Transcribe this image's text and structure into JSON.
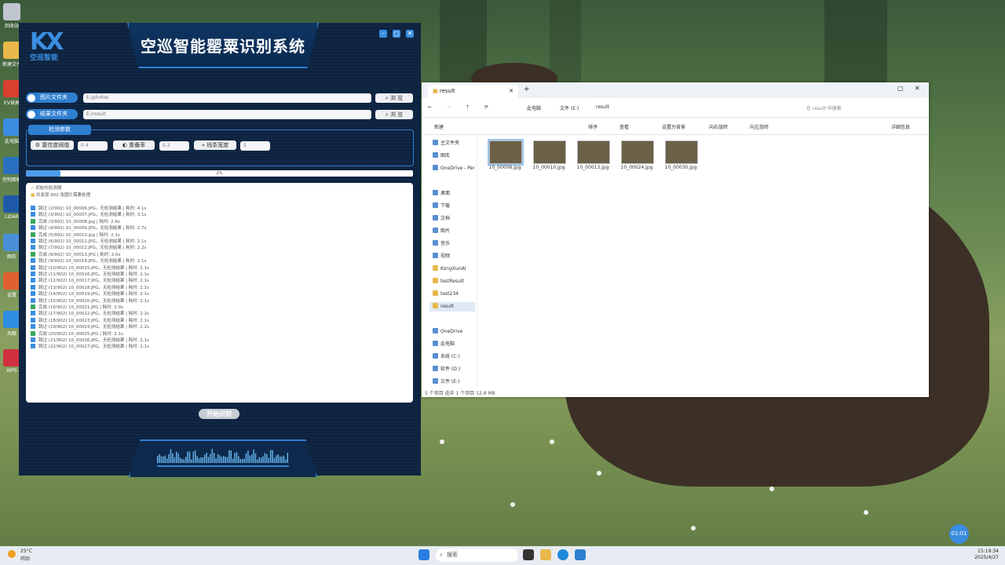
{
  "app": {
    "logo_text": "空巡智能",
    "title": "空巡智能罂粟识别系统",
    "window_buttons": [
      "–",
      "▢",
      "✕"
    ],
    "image_folder": {
      "label": "图片文件夹",
      "value": "E:/photos",
      "browse": "浏 览"
    },
    "result_folder": {
      "label": "结果文件夹",
      "value": "E:/result",
      "browse": "浏 览"
    },
    "params_title": "检测参数",
    "confidence": {
      "label": "置信度阈值",
      "value": "0.4"
    },
    "overlap": {
      "label": "重叠率",
      "value": "0.2"
    },
    "line_width": {
      "label": "线条宽度",
      "value": "5"
    },
    "progress_text": "2%",
    "progress": 0.02,
    "log_header": [
      "初始化检测器",
      "共发现 902 张图片需要处理"
    ],
    "log_lines": [
      {
        "status": "skip",
        "text": "跳过 (2/902) 10_00006.JPG，无检测结果 | 耗时: 4.1s"
      },
      {
        "status": "skip",
        "text": "跳过 (3/902) 10_00007.JPG，无检测结果 | 耗时: 3.1s"
      },
      {
        "status": "done",
        "text": "完成 (3/902) 10_00008.jpg | 耗时: 2.6s"
      },
      {
        "status": "skip",
        "text": "跳过 (4/902) 10_00009.JPG，无检测结果 | 耗时: 2.7s"
      },
      {
        "status": "done",
        "text": "完成 (5/902) 10_00010.jpg | 耗时: 2.1s"
      },
      {
        "status": "skip",
        "text": "跳过 (6/902) 10_00011.JPG，无检测结果 | 耗时: 2.1s"
      },
      {
        "status": "skip",
        "text": "跳过 (7/902) 10_00012.JPG，无检测结果 | 耗时: 2.2s"
      },
      {
        "status": "done",
        "text": "完成 (8/902) 10_00013.JPG | 耗时: 2.0s"
      },
      {
        "status": "skip",
        "text": "跳过 (9/902) 10_00014.JPG，无检测结果 | 耗时: 2.1s"
      },
      {
        "status": "skip",
        "text": "跳过 (10/902) 10_00015.JPG，无检测结果 | 耗时: 2.1s"
      },
      {
        "status": "skip",
        "text": "跳过 (11/902) 10_00016.JPG，无检测结果 | 耗时: 2.1s"
      },
      {
        "status": "skip",
        "text": "跳过 (12/902) 10_00017.JPG，无检测结果 | 耗时: 2.1s"
      },
      {
        "status": "skip",
        "text": "跳过 (13/902) 10_00018.JPG，无检测结果 | 耗时: 2.1s"
      },
      {
        "status": "skip",
        "text": "跳过 (14/902) 10_00019.JPG，无检测结果 | 耗时: 2.1s"
      },
      {
        "status": "skip",
        "text": "跳过 (15/902) 10_00020.JPG，无检测结果 | 耗时: 2.1s"
      },
      {
        "status": "done",
        "text": "完成 (16/902) 10_00021.JPG | 耗时: 2.0s"
      },
      {
        "status": "skip",
        "text": "跳过 (17/902) 10_00022.JPG，无检测结果 | 耗时: 2.2s"
      },
      {
        "status": "skip",
        "text": "跳过 (18/902) 10_00023.JPG，无检测结果 | 耗时: 2.1s"
      },
      {
        "status": "skip",
        "text": "跳过 (19/902) 10_00024.JPG，无检测结果 | 耗时: 2.2s"
      },
      {
        "status": "done",
        "text": "完成 (20/902) 10_00025.JPG | 耗时: 2.1s"
      },
      {
        "status": "skip",
        "text": "跳过 (21/902) 10_00026.JPG，无检测结果 | 耗时: 2.1s"
      },
      {
        "status": "skip",
        "text": "跳过 (22/902) 10_00027.JPG，无检测结果 | 耗时: 2.1s"
      }
    ],
    "start_button": "开始识别"
  },
  "explorer": {
    "tab_title": "result",
    "breadcrumb": [
      "此电脑",
      "文件 (E:)",
      "result"
    ],
    "search_placeholder": "在 result 中搜索",
    "commands": [
      "新建",
      "排序",
      "查看",
      "设置为背景",
      "向右旋转",
      "向左旋转",
      "详细信息"
    ],
    "nav": [
      {
        "label": "主文件夹",
        "type": "sys"
      },
      {
        "label": "图库",
        "type": "sys"
      },
      {
        "label": "OneDrive - Per",
        "type": "sys"
      },
      {
        "label": "桌面",
        "type": "sys"
      },
      {
        "label": "下载",
        "type": "sys"
      },
      {
        "label": "文档",
        "type": "sys"
      },
      {
        "label": "图片",
        "type": "sys"
      },
      {
        "label": "音乐",
        "type": "sys"
      },
      {
        "label": "视频",
        "type": "sys"
      },
      {
        "label": "KongXunAI",
        "type": "folder"
      },
      {
        "label": "testResult",
        "type": "folder"
      },
      {
        "label": "test234",
        "type": "folder"
      },
      {
        "label": "result",
        "type": "folder"
      },
      {
        "label": "OneDrive",
        "type": "sys"
      },
      {
        "label": "此电脑",
        "type": "sys"
      },
      {
        "label": "系统 (C:)",
        "type": "sys"
      },
      {
        "label": "软件 (D:)",
        "type": "sys"
      },
      {
        "label": "文件 (E:)",
        "type": "sys"
      }
    ],
    "files": [
      "10_00008.jpg",
      "10_00010.jpg",
      "10_00013.jpg",
      "10_00024.jpg",
      "10_00030.jpg"
    ],
    "status": "5 个项目    选中 1 个项目  12.8 MB"
  },
  "taskbar": {
    "search_label": "搜索",
    "weather": "25°C",
    "weather_sub": "晴朗",
    "time": "15:19:34",
    "date": "2025/4/27",
    "timer": "01:01"
  },
  "desktop": {
    "labels": [
      "回收站",
      "新建文件",
      "EV录屏",
      "此电脑",
      "控制面板",
      "LIDAR",
      "图形",
      "设置",
      "天眼",
      "WPS"
    ]
  }
}
